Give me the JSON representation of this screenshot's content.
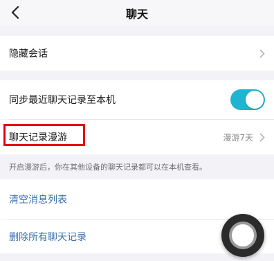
{
  "nav": {
    "title": "聊天",
    "back_icon": "chevron-left-icon"
  },
  "settings": {
    "hide_session": {
      "label": "隐藏会话"
    },
    "sync_recent": {
      "label": "同步最近聊天记录至本机",
      "enabled": true
    },
    "roaming": {
      "label": "聊天记录漫游",
      "value": "漫游7天"
    },
    "hint": "开启漫游后，你在其他设备的聊天记录都可以在本机查看。",
    "clear_list": {
      "label": "清空消息列表"
    },
    "delete_all": {
      "label": "删除所有聊天记录"
    }
  },
  "colors": {
    "toggle_on": "#1fb4d1",
    "link": "#3a6fb0",
    "highlight": "#e60012"
  }
}
